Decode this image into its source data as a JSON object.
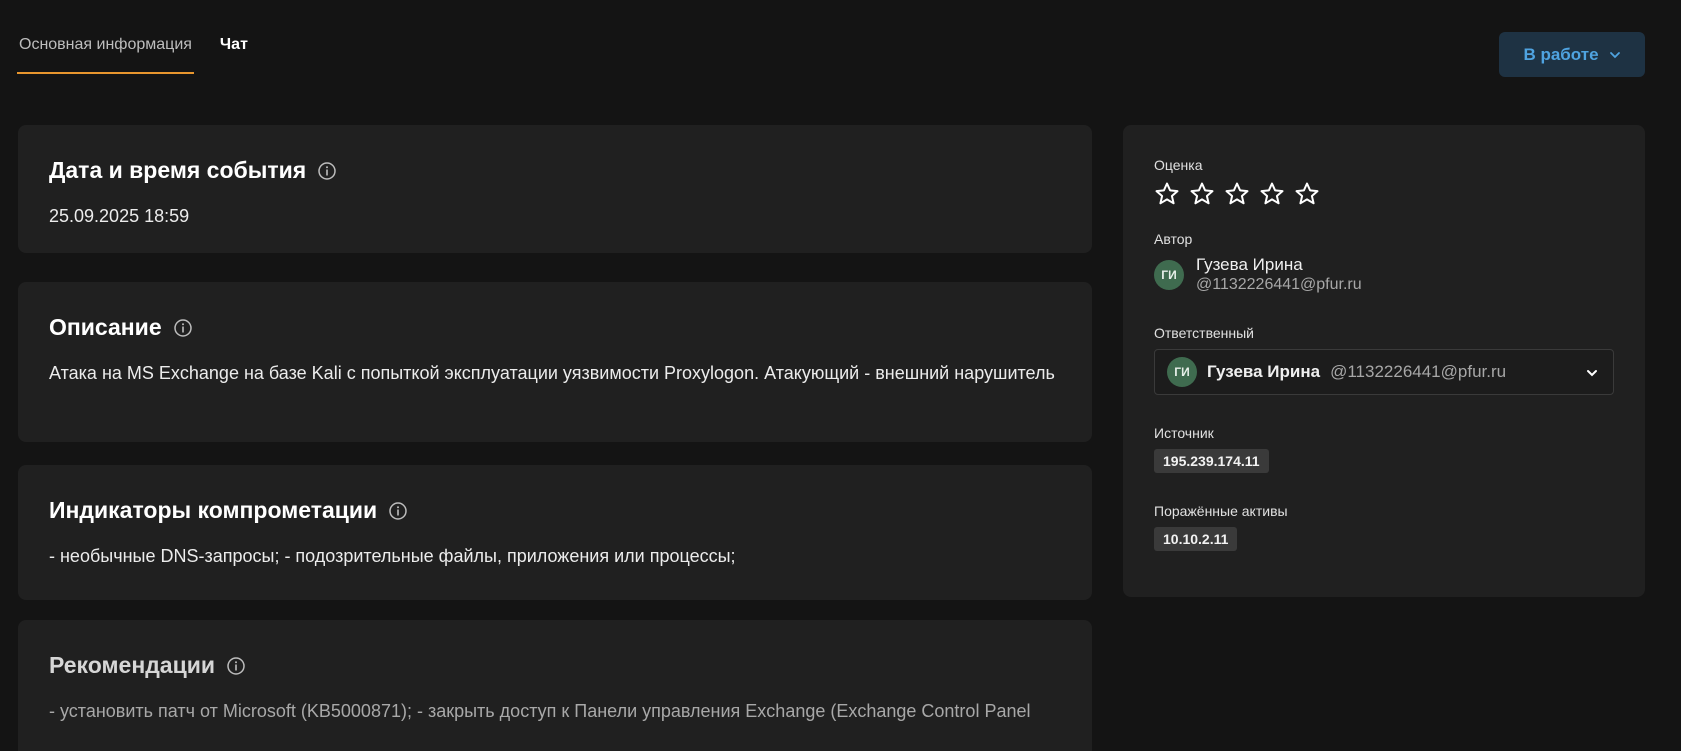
{
  "tabs": [
    {
      "label": "Основная информация"
    },
    {
      "label": "Чат"
    }
  ],
  "status": {
    "label": "В работе"
  },
  "event": {
    "title": "Дата и время события",
    "value": "25.09.2025 18:59"
  },
  "description": {
    "title": "Описание",
    "text": "Атака на MS Exchange на базе Kali с попыткой эксплуатации уязвимости Proxylogon. Атакующий - внешний нарушитель"
  },
  "indicators": {
    "title": "Индикаторы компрометации",
    "text": "- необычные DNS-запросы; - подозрительные файлы, приложения или процессы;"
  },
  "recommendations": {
    "title": "Рекомендации",
    "text": "- установить патч от Microsoft (KB5000871); - закрыть доступ к Панели управления Exchange (Exchange Control Panel"
  },
  "side": {
    "rating_label": "Оценка",
    "rating": {
      "value": 0,
      "max": 5
    },
    "author_label": "Автор",
    "author": {
      "initials": "ГИ",
      "name": "Гузева Ирина",
      "email": "@1132226441@pfur.ru"
    },
    "assignee_label": "Ответственный",
    "assignee": {
      "initials": "ГИ",
      "name": "Гузева Ирина",
      "email": "@1132226441@pfur.ru"
    },
    "source_label": "Источник",
    "source": "195.239.174.11",
    "assets_label": "Поражённые активы",
    "assets": "10.10.2.11"
  },
  "colors": {
    "accent": "#e8962e",
    "status_text": "#4fa3e0",
    "status_bg": "#1e3243",
    "avatar_bg": "#3f6b4f"
  },
  "icons": {
    "info": "info-circle-icon",
    "star": "star-outline-icon",
    "chevron": "chevron-down-icon"
  }
}
